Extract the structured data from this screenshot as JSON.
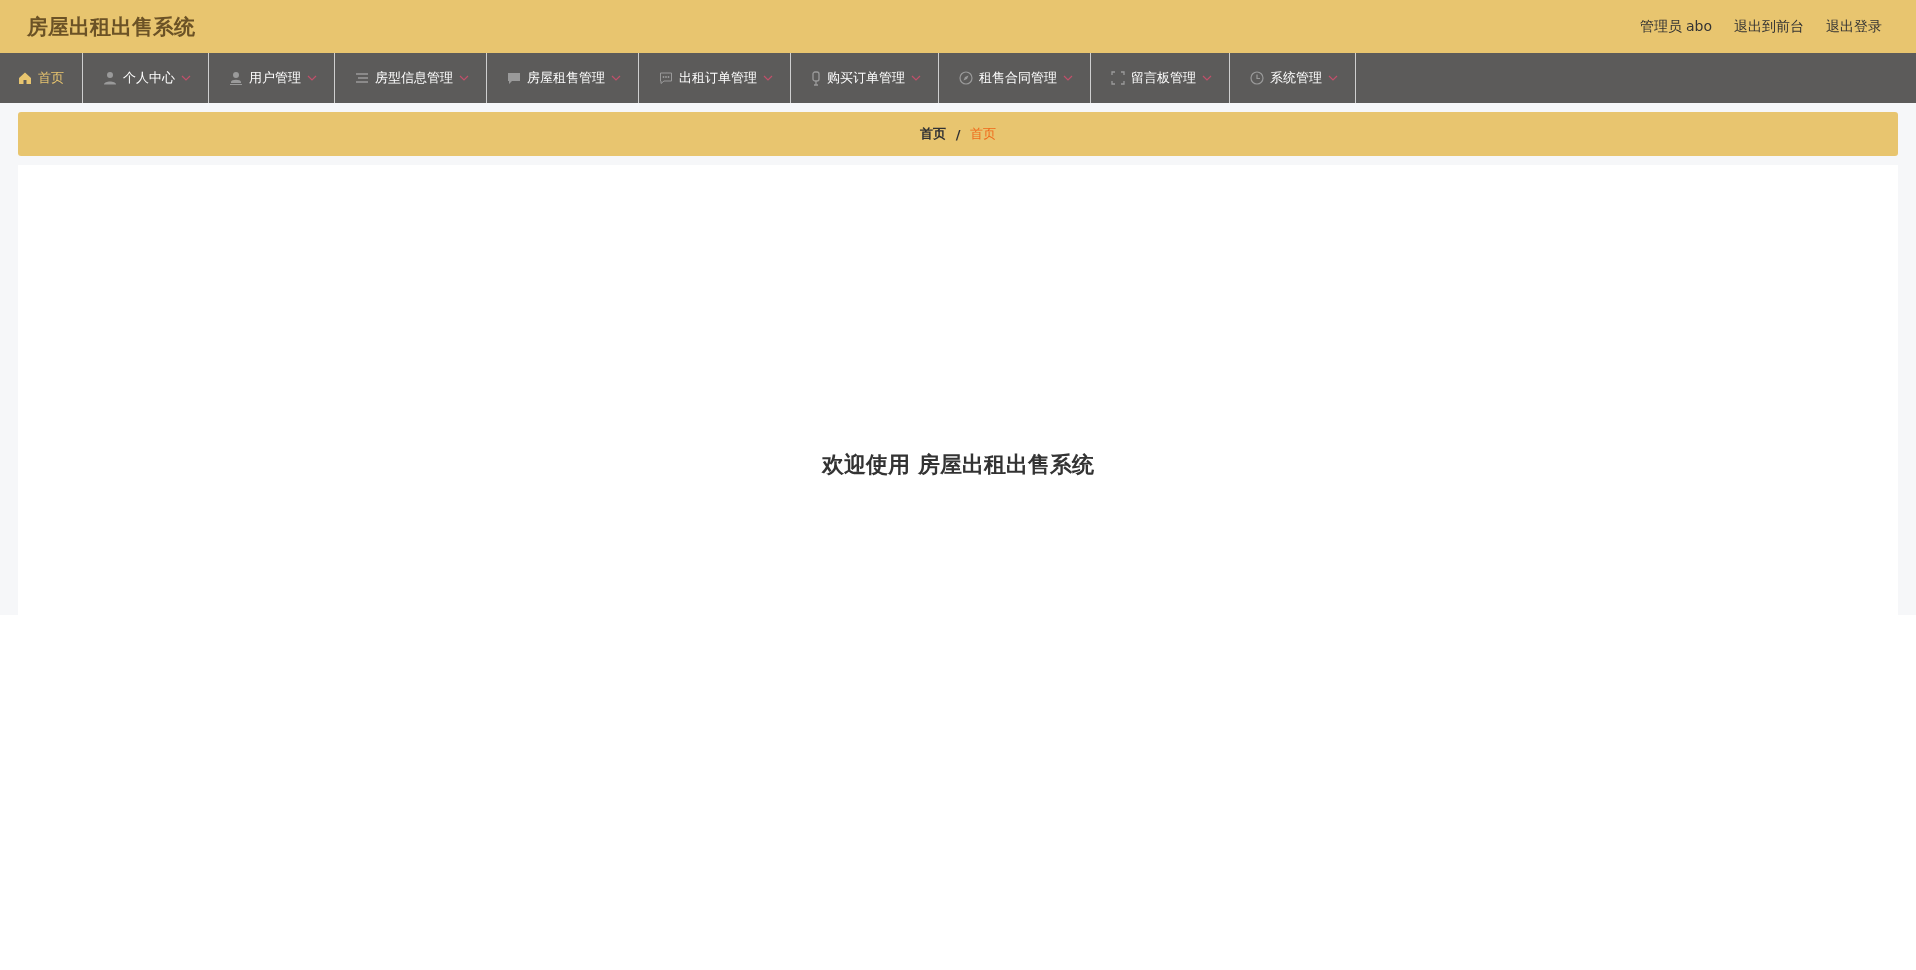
{
  "header": {
    "title": "房屋出租出售系统",
    "user": "管理员 abo",
    "links": [
      "退出到前台",
      "退出登录"
    ]
  },
  "nav": [
    {
      "label": "首页",
      "selected": true,
      "dropdown": false
    },
    {
      "label": "个人中心",
      "selected": false,
      "dropdown": true
    },
    {
      "label": "用户管理",
      "selected": false,
      "dropdown": true
    },
    {
      "label": "房型信息管理",
      "selected": false,
      "dropdown": true
    },
    {
      "label": "房屋租售管理",
      "selected": false,
      "dropdown": true
    },
    {
      "label": "出租订单管理",
      "selected": false,
      "dropdown": true
    },
    {
      "label": "购买订单管理",
      "selected": false,
      "dropdown": true
    },
    {
      "label": "租售合同管理",
      "selected": false,
      "dropdown": true
    },
    {
      "label": "留言板管理",
      "selected": false,
      "dropdown": true
    },
    {
      "label": "系统管理",
      "selected": false,
      "dropdown": true
    }
  ],
  "breadcrumb": [
    {
      "label": "首页",
      "current": false
    },
    {
      "label": "首页",
      "current": true
    }
  ],
  "breadcrumb_separator": "/",
  "welcome": "欢迎使用 房屋出租出售系统"
}
